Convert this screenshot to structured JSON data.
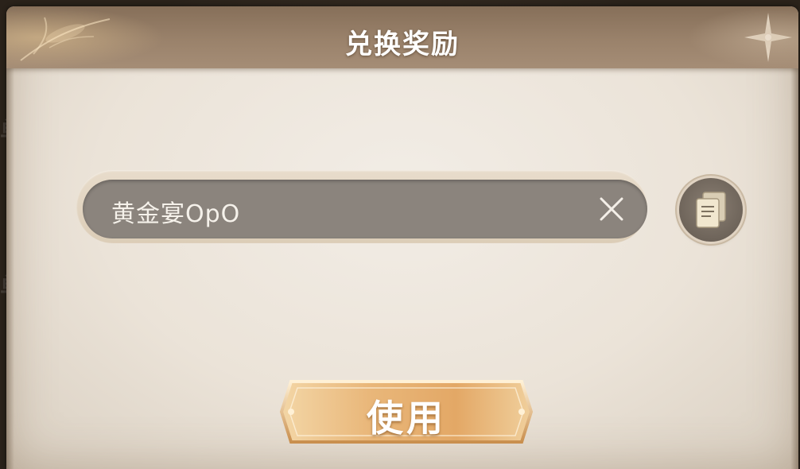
{
  "dialog": {
    "title": "兑换奖励"
  },
  "redeem": {
    "code_value": "黄金宴OpO",
    "clear_icon": "close-icon",
    "paste_icon": "clipboard-icon"
  },
  "actions": {
    "use_label": "使用"
  },
  "colors": {
    "title_bar": "#9a826b",
    "panel_bg": "#efe8df",
    "input_bg": "#8b847d",
    "button_gold": "#e9b77a",
    "text_white": "#ffffff"
  }
}
